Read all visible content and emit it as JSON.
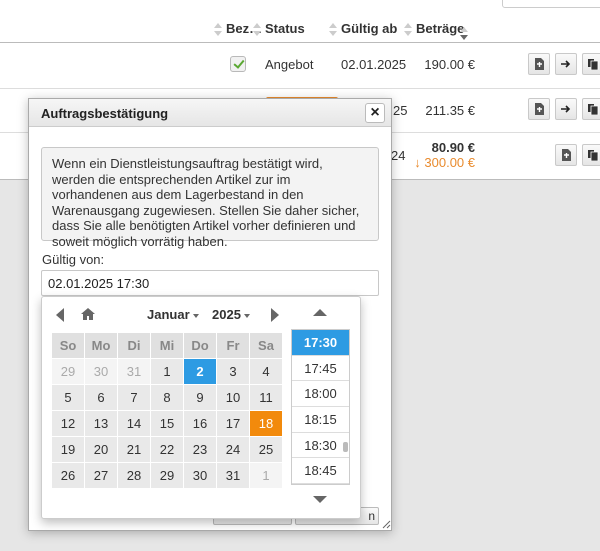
{
  "table": {
    "headers": {
      "bezahlt": "Bez…",
      "status": "Status",
      "gueltig_ab": "Gültig ab",
      "betraege": "Beträge"
    },
    "rows": [
      {
        "status": "Angebot",
        "gueltig_ab": "02.01.2025",
        "betrag": "190.00 €",
        "bezahlt": true
      },
      {
        "gueltig_ab_fragment": "25",
        "betrag": "211.35 €"
      }
    ],
    "summary": {
      "date_fragment": "24",
      "total": "80.90 €",
      "open": "↓ 300.00 €"
    },
    "colors": {
      "accent_orange": "#e98b2e"
    }
  },
  "dialog": {
    "title": "Auftragsbestätigung",
    "close_icon": "close-icon",
    "info_text": "Wenn ein Dienstleistungsauftrag bestätigt wird, werden die entsprechenden Artikel zur im vorhandenen aus dem Lagerbestand in den Warenausgang zugewiesen. Stellen Sie daher sicher, dass Sie alle benötigten Artikel vorher definieren und soweit möglich vorrätig haben.",
    "valid_from_label": "Gültig von:",
    "valid_from_value": "02.01.2025 17:30",
    "footer_button_1_fragment": "",
    "footer_button_2_fragment": "n"
  },
  "datepicker": {
    "month": "Januar",
    "year": "2025",
    "weekdays": [
      "So",
      "Mo",
      "Di",
      "Mi",
      "Do",
      "Fr",
      "Sa"
    ],
    "weeks": [
      [
        {
          "d": "29",
          "m": true
        },
        {
          "d": "30",
          "m": true
        },
        {
          "d": "31",
          "m": true
        },
        {
          "d": "1"
        },
        {
          "d": "2",
          "s": true
        },
        {
          "d": "3"
        },
        {
          "d": "4"
        }
      ],
      [
        {
          "d": "5"
        },
        {
          "d": "6"
        },
        {
          "d": "7"
        },
        {
          "d": "8"
        },
        {
          "d": "9"
        },
        {
          "d": "10"
        },
        {
          "d": "11"
        }
      ],
      [
        {
          "d": "12"
        },
        {
          "d": "13"
        },
        {
          "d": "14"
        },
        {
          "d": "15"
        },
        {
          "d": "16"
        },
        {
          "d": "17"
        },
        {
          "d": "18",
          "t": true
        }
      ],
      [
        {
          "d": "19"
        },
        {
          "d": "20"
        },
        {
          "d": "21"
        },
        {
          "d": "22"
        },
        {
          "d": "23"
        },
        {
          "d": "24"
        },
        {
          "d": "25"
        }
      ],
      [
        {
          "d": "26"
        },
        {
          "d": "27"
        },
        {
          "d": "28"
        },
        {
          "d": "29"
        },
        {
          "d": "30"
        },
        {
          "d": "31"
        },
        {
          "d": "1",
          "m": true
        }
      ]
    ],
    "times": [
      "17:30",
      "17:45",
      "18:00",
      "18:15",
      "18:30",
      "18:45"
    ],
    "selected_time": "17:30",
    "colors": {
      "selected": "#2d9be3",
      "today": "#f28a0c"
    }
  }
}
